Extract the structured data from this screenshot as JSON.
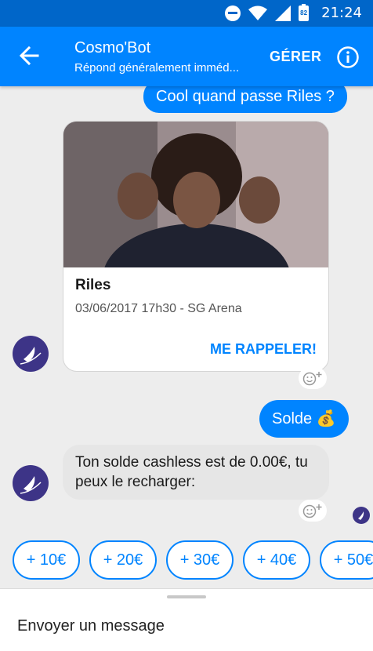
{
  "status_bar": {
    "time": "21:24",
    "battery": "82"
  },
  "header": {
    "title": "Cosmo'Bot",
    "subtitle": "Répond généralement imméd...",
    "manage_label": "GÉRER"
  },
  "messages": {
    "outgoing_1": "Cool quand passe Riles ?",
    "card": {
      "title": "Riles",
      "subtitle": "03/06/2017 17h30 - SG Arena",
      "action": "ME RAPPELER!"
    },
    "outgoing_2": "Solde 💰",
    "incoming_1": "Ton solde cashless est de 0.00€, tu peux le recharger:"
  },
  "quick_replies": [
    "+ 10€",
    "+ 20€",
    "+ 30€",
    "+ 40€",
    "+ 50€"
  ],
  "composer": {
    "placeholder": "Envoyer un message"
  },
  "colors": {
    "status_bar": "#0066c9",
    "header": "#0084ff",
    "accent": "#0084ff",
    "bot_avatar": "#3d3487"
  }
}
